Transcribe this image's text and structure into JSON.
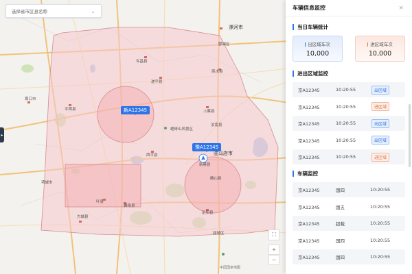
{
  "region_select": {
    "placeholder": "选择省市区县名称"
  },
  "map": {
    "cities": [
      "漯河市",
      "驻马店市"
    ],
    "labels": [
      "周口市",
      "许昌县",
      "商水县",
      "汝南县",
      "平舆县",
      "遂平县",
      "上蔡县",
      "西平县",
      "叶县",
      "舞阳县",
      "郾城区",
      "确山县",
      "泌阳县",
      "方城县",
      "新蔡县",
      "项城市",
      "嵖岈山风景区",
      "驿城区",
      "中国国家地图"
    ],
    "vehicles": [
      {
        "plate": "新A12345"
      },
      {
        "plate": "豫A12345"
      }
    ],
    "controls": {
      "fullscreen": "⛶",
      "zoom_in": "+",
      "zoom_out": "−"
    },
    "colors": {
      "fence_fill": "#f6c9cc",
      "fence_stroke": "#d98a92",
      "vehicle_tag": "#2f74e6"
    }
  },
  "panel": {
    "title": "车辆信息监控",
    "close": "×",
    "stats_section": {
      "title": "当日车辆统计",
      "out_label": "出区域车次",
      "out_value": "10,000",
      "in_label": "进区域车次",
      "in_value": "10,000"
    },
    "region_section": {
      "title": "进出区域监控",
      "rows": [
        {
          "plate": "京A12345",
          "time": "10:20:55",
          "status": "出区域",
          "type": "out"
        },
        {
          "plate": "京A12345",
          "time": "10:20:55",
          "status": "进区域",
          "type": "in"
        },
        {
          "plate": "京A12345",
          "time": "10:20:55",
          "status": "出区域",
          "type": "out"
        },
        {
          "plate": "京A12345",
          "time": "10:20:55",
          "status": "出区域",
          "type": "out"
        },
        {
          "plate": "京A12345",
          "time": "10:20:55",
          "status": "进区域",
          "type": "in"
        }
      ]
    },
    "vehicle_section": {
      "title": "车辆监控",
      "rows": [
        {
          "plate": "京A12345",
          "standard": "国四",
          "time": "10:20:55"
        },
        {
          "plate": "京A12345",
          "standard": "国五",
          "time": "10:20:55"
        },
        {
          "plate": "京A12345",
          "standard": "超载",
          "time": "10:20:55"
        },
        {
          "plate": "京A12345",
          "standard": "国四",
          "time": "10:20:55"
        },
        {
          "plate": "京A12345",
          "standard": "国四",
          "time": "10:20:55"
        }
      ]
    }
  }
}
